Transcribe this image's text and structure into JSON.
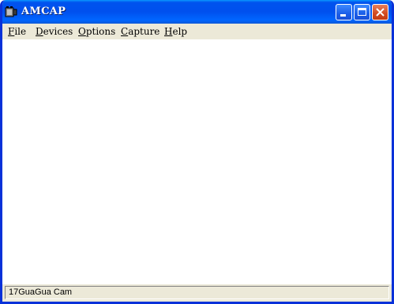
{
  "window": {
    "title": "AMCAP",
    "icon": "camera-film-icon",
    "controls": [
      "minimize",
      "maximize",
      "close"
    ]
  },
  "menu": {
    "items": [
      {
        "label_underline": "F",
        "label_rest": "ile"
      },
      {
        "label_underline": "D",
        "label_rest": "evices"
      },
      {
        "label_underline": "O",
        "label_rest": "ptions"
      },
      {
        "label_underline": "C",
        "label_rest": "apture"
      },
      {
        "label_underline": "H",
        "label_rest": "elp"
      }
    ]
  },
  "status": {
    "text": "17GuaGua Cam"
  },
  "colors": {
    "titlebar": "#0053ee",
    "frame": "#0831d9",
    "close_button": "#d24a20",
    "chrome": "#ece9d8"
  }
}
